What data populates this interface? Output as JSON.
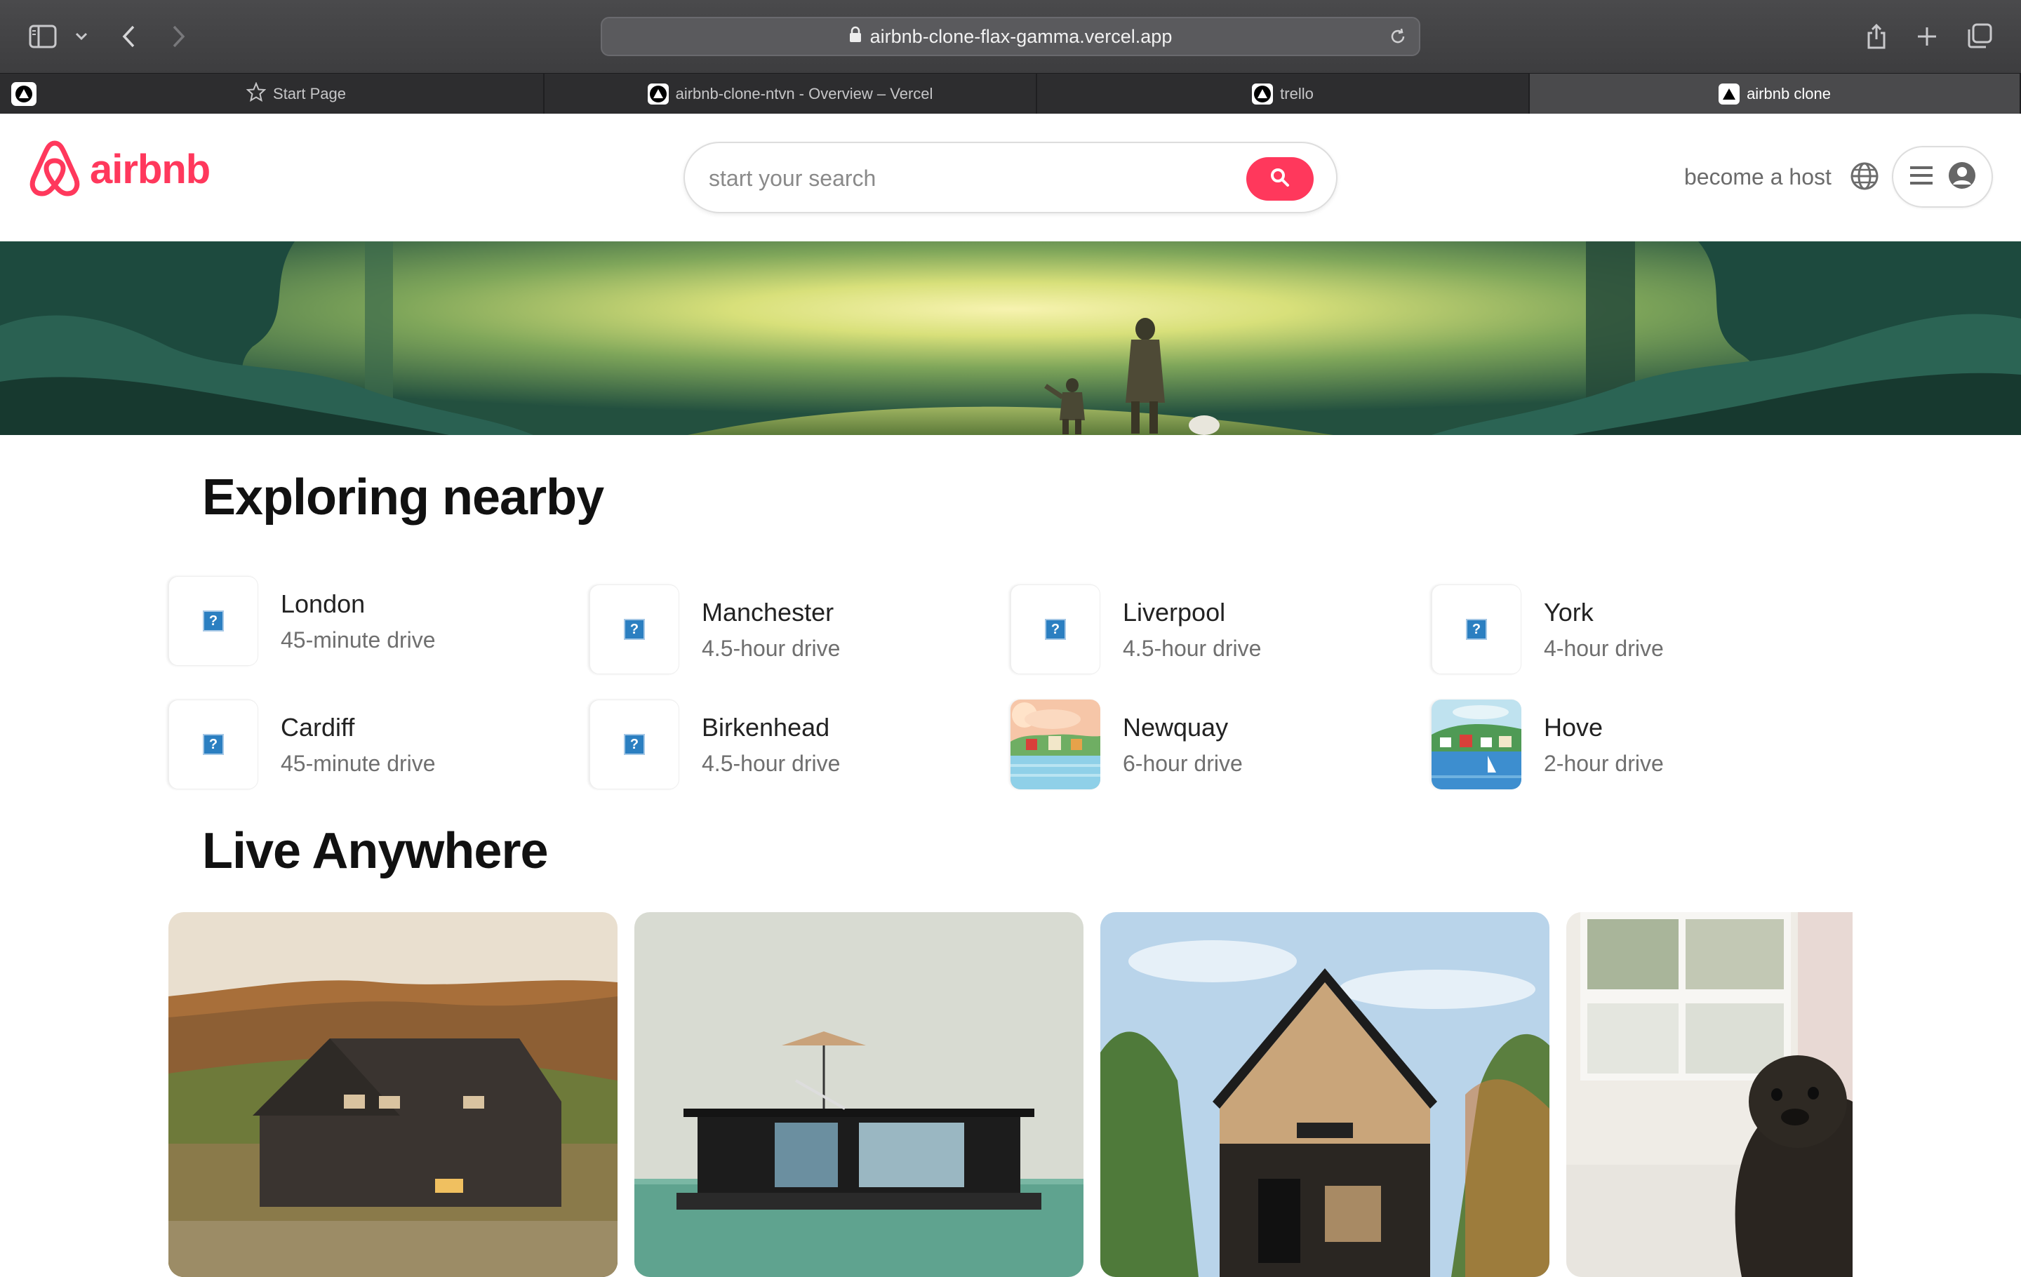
{
  "browser": {
    "url": "airbnb-clone-flax-gamma.vercel.app",
    "tabs": [
      {
        "label": "Start Page"
      },
      {
        "label": "airbnb-clone-ntvn - Overview – Vercel"
      },
      {
        "label": "trello"
      },
      {
        "label": "airbnb clone"
      }
    ]
  },
  "header": {
    "logo_text": "airbnb",
    "search_placeholder": "start your search",
    "become_host": "become a host"
  },
  "nearby": {
    "title": "Exploring nearby",
    "items": [
      {
        "city": "London",
        "drive": "45-minute drive"
      },
      {
        "city": "Manchester",
        "drive": "4.5-hour drive"
      },
      {
        "city": "Liverpool",
        "drive": "4.5-hour drive"
      },
      {
        "city": "York",
        "drive": "4-hour drive"
      },
      {
        "city": "Cardiff",
        "drive": "45-minute drive"
      },
      {
        "city": "Birkenhead",
        "drive": "4.5-hour drive"
      },
      {
        "city": "Newquay",
        "drive": "6-hour drive"
      },
      {
        "city": "Hove",
        "drive": "2-hour drive"
      }
    ]
  },
  "live": {
    "title": "Live Anywhere"
  },
  "colors": {
    "brand": "#ff385c",
    "chrome": "#3d3d3f"
  }
}
